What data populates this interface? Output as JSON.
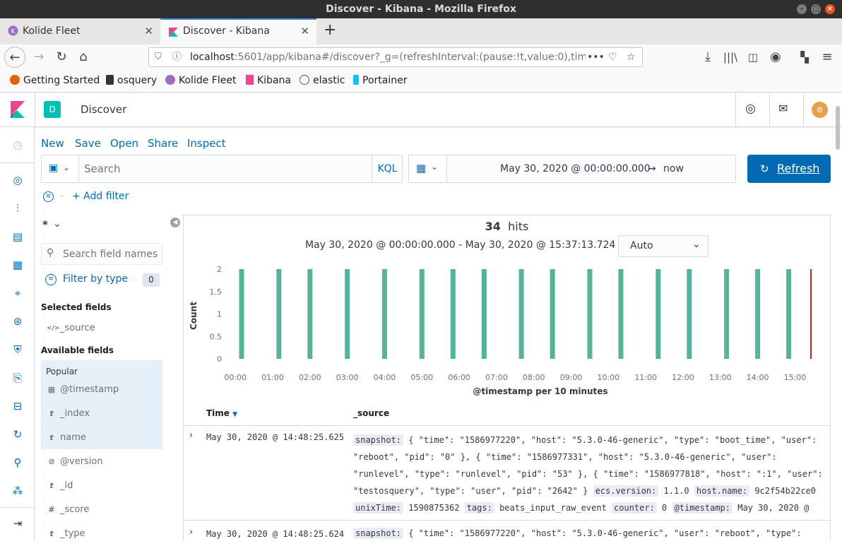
{
  "window": {
    "title": "Discover - Kibana - Mozilla Firefox"
  },
  "tabs": [
    {
      "label": "Kolide Fleet",
      "active": false
    },
    {
      "label": "Discover - Kibana",
      "active": true
    }
  ],
  "url": {
    "host": "localhost",
    "rest": ":5601/app/kibana#/discover?_g=(refreshInterval:(pause:!t,value:0),time:(fr"
  },
  "bookmarks": [
    {
      "label": "Getting Started",
      "icon": "firefox-icon"
    },
    {
      "label": "osquery",
      "icon": "bookmark-icon"
    },
    {
      "label": "Kolide Fleet",
      "icon": "kolide-icon"
    },
    {
      "label": "Kibana",
      "icon": "kibana-icon"
    },
    {
      "label": "elastic",
      "icon": "globe-icon"
    },
    {
      "label": "Portainer",
      "icon": "portainer-icon"
    }
  ],
  "header": {
    "space_initial": "D",
    "title": "Discover",
    "user_initial": "e"
  },
  "toolbar": {
    "new": "New",
    "save": "Save",
    "open": "Open",
    "share": "Share",
    "inspect": "Inspect"
  },
  "search": {
    "placeholder": "Search",
    "language": "KQL"
  },
  "time": {
    "start": "May 30, 2020 @ 00:00:00.000",
    "arrow": "→",
    "end": "now",
    "refresh": "Refresh"
  },
  "filter": {
    "add": "+ Add filter"
  },
  "sidebar": {
    "index_pattern": "*",
    "search_placeholder": "Search field names",
    "filter_by_type": "Filter by type",
    "filter_count": "0",
    "selected_heading": "Selected fields",
    "selected": [
      {
        "type": "</>",
        "name": "_source"
      }
    ],
    "available_heading": "Available fields",
    "popular_heading": "Popular",
    "popular": [
      {
        "type": "▦",
        "name": "@timestamp"
      },
      {
        "type": "t",
        "name": "_index"
      },
      {
        "type": "t",
        "name": "name"
      }
    ],
    "other": [
      {
        "type": "⊘",
        "name": "@version"
      },
      {
        "type": "t",
        "name": "_id"
      },
      {
        "type": "#",
        "name": "_score"
      },
      {
        "type": "t",
        "name": "_type"
      }
    ]
  },
  "hits": {
    "count": "34",
    "label": "hits",
    "range": "May 30, 2020 @ 00:00:00.000 - May 30, 2020 @ 15:37:13.724 —",
    "interval": "Auto"
  },
  "chart_data": {
    "type": "bar",
    "xlabel": "@timestamp per 10 minutes",
    "ylabel": "Count",
    "ylim": [
      0,
      2
    ],
    "yticks": [
      "0",
      "0.5",
      "1",
      "1.5",
      "2"
    ],
    "xticks": [
      "00:00",
      "01:00",
      "02:00",
      "03:00",
      "04:00",
      "05:00",
      "06:00",
      "07:00",
      "08:00",
      "09:00",
      "10:00",
      "11:00",
      "12:00",
      "13:00",
      "14:00",
      "15:00"
    ],
    "bar_times": [
      "00:10",
      "01:10",
      "02:00",
      "03:00",
      "04:00",
      "05:00",
      "05:50",
      "06:40",
      "07:40",
      "08:30",
      "09:30",
      "10:20",
      "11:20",
      "12:10",
      "13:10",
      "14:00",
      "14:50"
    ],
    "values": [
      2,
      2,
      2,
      2,
      2,
      2,
      2,
      2,
      2,
      2,
      2,
      2,
      2,
      2,
      2,
      2,
      2
    ],
    "color": "#54b399",
    "now_marker_color": "#bd271e"
  },
  "table": {
    "col_time": "Time",
    "col_source": "_source",
    "rows": [
      {
        "time": "May 30, 2020 @ 14:48:25.625",
        "line1": [
          {
            "k": "snapshot:",
            "v": " { \"time\": \"1586977220\", \"host\": \"5.3.0-46-generic\", \"type\": \"boot_time\", \"user\":"
          }
        ],
        "line2": "\"reboot\", \"pid\": \"0\" }, { \"time\": \"1586977331\", \"host\": \"5.3.0-46-generic\", \"user\":",
        "line3": "\"runlevel\", \"type\": \"runlevel\", \"pid\": \"53\" }, { \"time\": \"1586977818\", \"host\": \":1\", \"user\":",
        "line4a": "\"testosquery\", \"type\": \"user\", \"pid\": \"2642\" } ",
        "k_ecs": "ecs.version:",
        "v_ecs": " 1.1.0 ",
        "k_host": "host.name:",
        "v_host": " 9c2f54b22ce0",
        "k_unix": "unixTime:",
        "v_unix": " 1590875362 ",
        "k_tags": "tags:",
        "v_tags": " beats_input_raw_event ",
        "k_counter": "counter:",
        "v_counter": " 0 ",
        "k_ts": "@timestamp:",
        "v_ts": " May 30, 2020 @"
      },
      {
        "time": "May 30, 2020 @ 14:48:25.624",
        "k": "snapshot:",
        "v": " { \"time\": \"1586977220\", \"host\": \"5.3.0-46-generic\", \"user\": \"reboot\", \"type\":"
      }
    ]
  }
}
